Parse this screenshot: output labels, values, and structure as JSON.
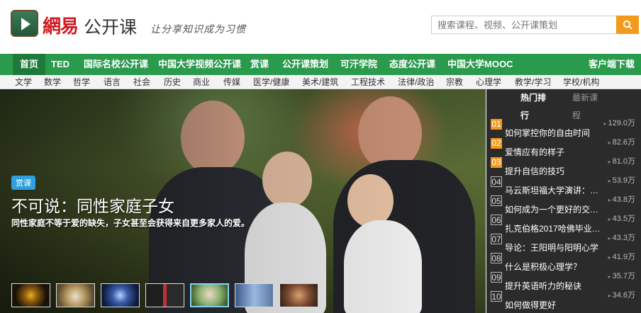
{
  "header": {
    "logo_netease": "網易",
    "logo_open": "公开课",
    "slogan": "让分享知识成为习惯",
    "search_placeholder": "搜索课程、视频、公开课策划",
    "search_icon": "search-icon"
  },
  "mainnav": {
    "items": [
      "首页",
      "TED",
      "国际名校公开课",
      "中国大学视频公开课",
      "赏课",
      "公开课策划",
      "可汗学院",
      "态度公开课",
      "中国大学MOOC"
    ],
    "download": "客户端下载"
  },
  "subnav": {
    "items": [
      "文学",
      "数学",
      "哲学",
      "语言",
      "社会",
      "历史",
      "商业",
      "传媒",
      "医学/健康",
      "美术/建筑",
      "工程技术",
      "法律/政治",
      "宗教",
      "心理学",
      "教学/学习",
      "学校/机构"
    ]
  },
  "hero": {
    "badge": "赏课",
    "title": "不可说：同性家庭子女",
    "desc": "同性家庭不等于爱的缺失，子女甚至会获得来自更多家人的爱。",
    "thumbnail_count": 7,
    "selected_thumbnail": 5
  },
  "sidebar": {
    "tab_hot_1": "热门排",
    "tab_hot_2": "行",
    "tab_new_1": "最新课",
    "tab_new_2": "程",
    "items": [
      {
        "rank": "01",
        "title": "如何掌控你的自由时间",
        "views": "129.0万"
      },
      {
        "rank": "02",
        "title": "爱情应有的样子",
        "views": "82.6万"
      },
      {
        "rank": "03",
        "title": "提升自信的技巧",
        "views": "81.0万"
      },
      {
        "rank": "04",
        "title": "马云斯坦福大学演讲：…",
        "views": "53.9万"
      },
      {
        "rank": "05",
        "title": "如何成为一个更好的交…",
        "views": "43.8万"
      },
      {
        "rank": "06",
        "title": "扎克伯格2017哈佛毕业…",
        "views": "43.5万"
      },
      {
        "rank": "07",
        "title": "导论：王阳明与阳明心学",
        "views": "43.3万"
      },
      {
        "rank": "08",
        "title": "什么是积极心理学？",
        "views": "41.9万"
      },
      {
        "rank": "09",
        "title": "提升英语听力的秘诀",
        "views": "35.7万"
      },
      {
        "rank": "10",
        "title": "如何做得更好",
        "views": "34.6万"
      }
    ]
  },
  "colors": {
    "nav_green": "#2a9a4d",
    "nav_active": "#1e7a3a",
    "accent_orange": "#f19a1b",
    "logo_red": "#d0181f",
    "sidebar_bg": "#2b2b2b",
    "badge_blue": "#2fa0df"
  }
}
